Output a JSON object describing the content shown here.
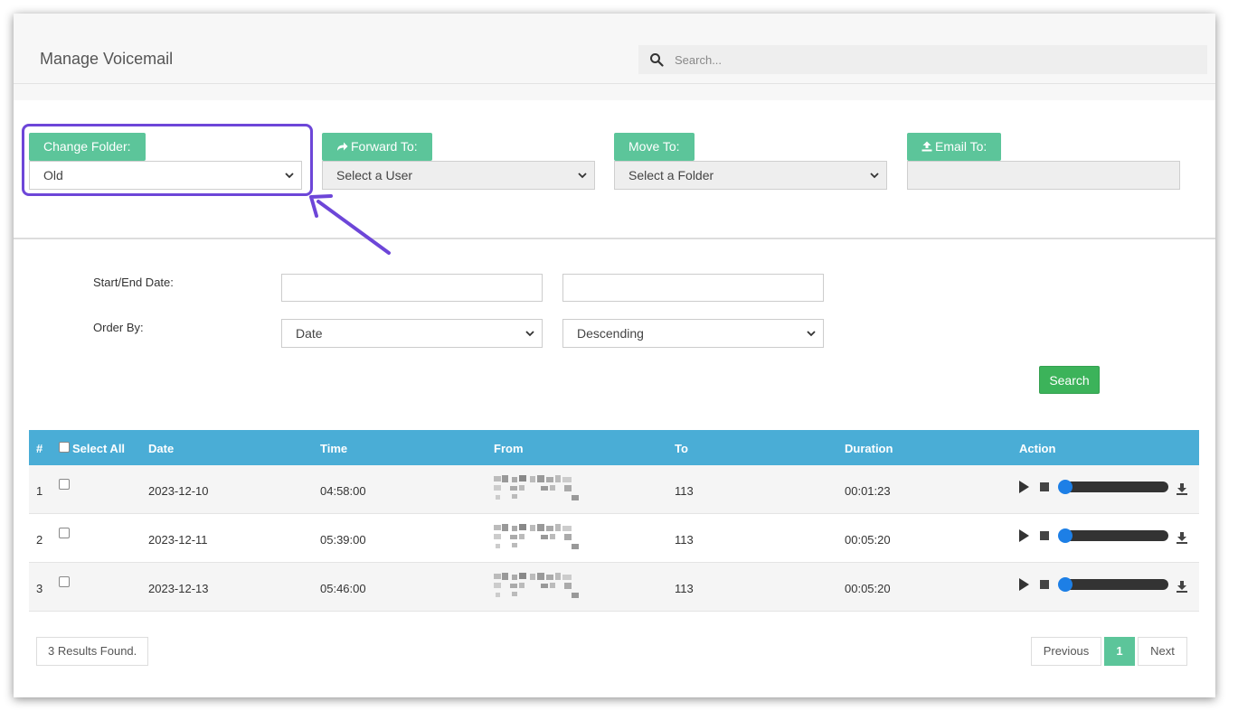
{
  "header": {
    "title": "Manage Voicemail",
    "search_placeholder": "Search..."
  },
  "actions": {
    "change_folder": {
      "label": "Change Folder:",
      "value": "Old"
    },
    "forward_to": {
      "label": "Forward To:",
      "value": "Select a User"
    },
    "move_to": {
      "label": "Move To:",
      "value": "Select a Folder"
    },
    "email_to": {
      "label": "Email To:",
      "value": ""
    }
  },
  "filters": {
    "date_label": "Start/End Date:",
    "order_label": "Order By:",
    "order_field": "Date",
    "order_direction": "Descending",
    "search_button": "Search"
  },
  "table": {
    "headers": {
      "num": "#",
      "select_all": "Select All",
      "date": "Date",
      "time": "Time",
      "from": "From",
      "to": "To",
      "duration": "Duration",
      "action": "Action"
    },
    "rows": [
      {
        "num": "1",
        "date": "2023-12-10",
        "time": "04:58:00",
        "to": "113",
        "duration": "00:01:23"
      },
      {
        "num": "2",
        "date": "2023-12-11",
        "time": "05:39:00",
        "to": "113",
        "duration": "00:05:20"
      },
      {
        "num": "3",
        "date": "2023-12-13",
        "time": "05:46:00",
        "to": "113",
        "duration": "00:05:20"
      }
    ]
  },
  "footer": {
    "results": "3 Results Found.",
    "previous": "Previous",
    "page": "1",
    "next": "Next"
  },
  "colors": {
    "accent_green": "#5cc59a",
    "table_header": "#4aadd6",
    "search_button": "#3cb35a",
    "highlight": "#6d46d8"
  }
}
